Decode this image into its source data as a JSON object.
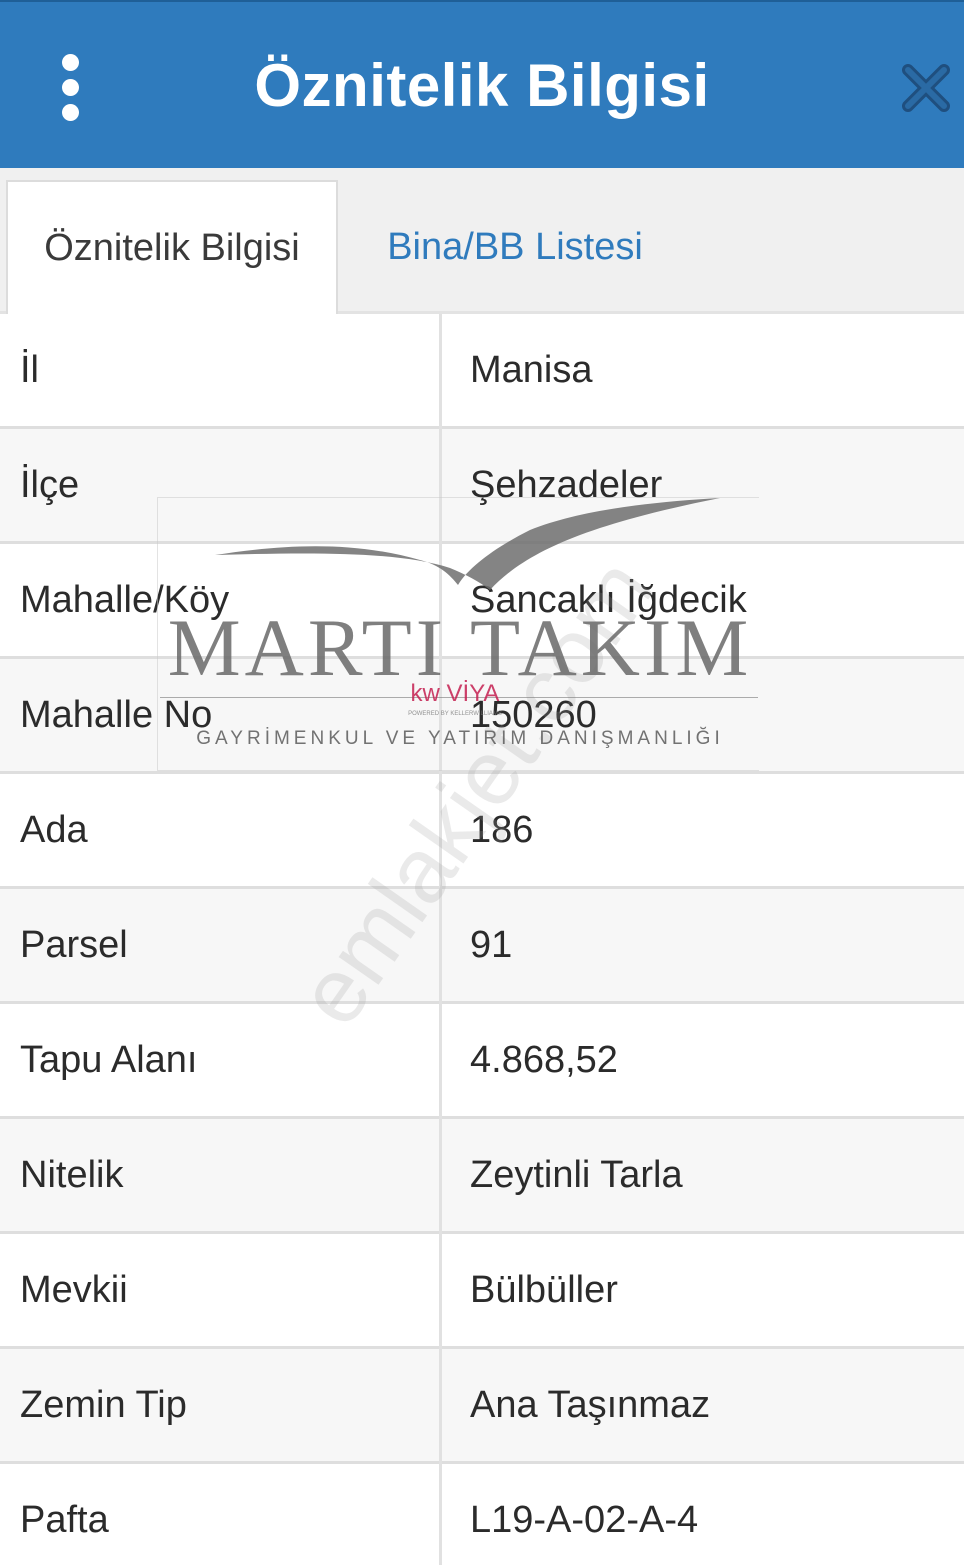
{
  "header": {
    "title": "Öznitelik Bilgisi",
    "menu_icon": "more-vertical-icon",
    "close_icon": "close-icon"
  },
  "tabs": [
    {
      "label": "Öznitelik Bilgisi",
      "active": true
    },
    {
      "label": "Bina/BB Listesi",
      "active": false
    }
  ],
  "rows": [
    {
      "label": "İl",
      "value": "Manisa"
    },
    {
      "label": "İlçe",
      "value": "Şehzadeler"
    },
    {
      "label": "Mahalle/Köy",
      "value": "Sancaklı İğdecik"
    },
    {
      "label": "Mahalle No",
      "value": "150260"
    },
    {
      "label": "Ada",
      "value": "186"
    },
    {
      "label": "Parsel",
      "value": "91"
    },
    {
      "label": "Tapu Alanı",
      "value": "4.868,52"
    },
    {
      "label": "Nitelik",
      "value": "Zeytinli Tarla"
    },
    {
      "label": "Mevkii",
      "value": "Bülbüller"
    },
    {
      "label": "Zemin Tip",
      "value": "Ana Taşınmaz"
    },
    {
      "label": "Pafta",
      "value": "L19-A-02-A-4"
    }
  ],
  "watermark": {
    "brand": "MARTI TAKIM",
    "partner": "kw VİYA",
    "partner_sub": "POWERED BY KELLERWILLIAMS",
    "tagline": "GAYRİMENKUL VE YATIRIM DANIŞMANLIĞI",
    "site": "emlakjet.com"
  },
  "colors": {
    "header_bg": "#2f7bbd",
    "accent": "#2f7bbd",
    "text": "#2b2b2b"
  }
}
